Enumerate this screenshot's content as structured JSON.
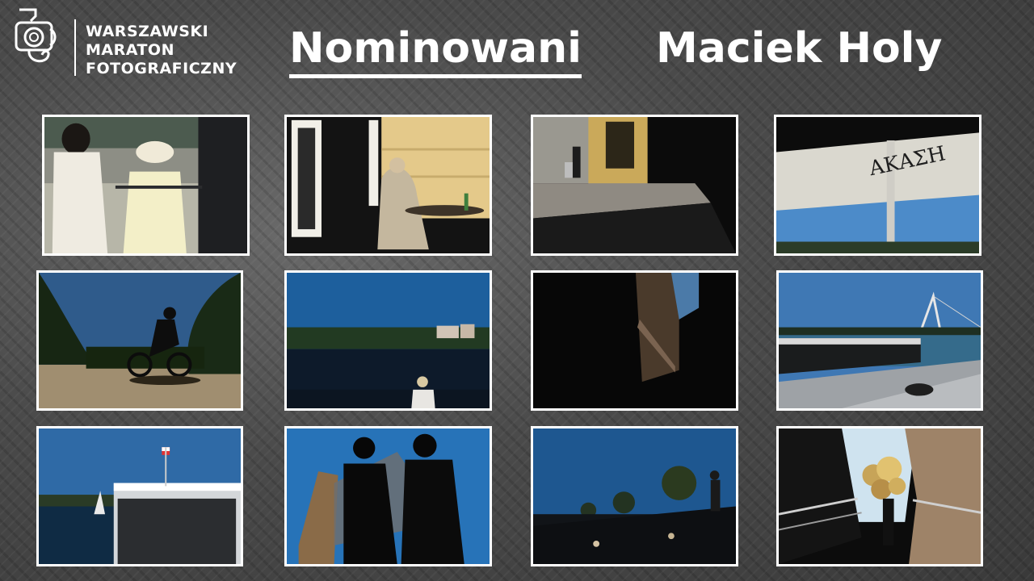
{
  "brand": {
    "logo_icon": "camera-heart-icon",
    "line1": "WARSZAWSKI",
    "line2": "MARATON",
    "line3": "FOTOGRAFICZNY"
  },
  "header": {
    "section_title": "Nominowani",
    "author_name": "Maciek Holy"
  },
  "gallery": {
    "photos": [
      {
        "id": "street-women-watching-parade"
      },
      {
        "id": "man-sitting-at-cafe-table"
      },
      {
        "id": "courtyard-shadow-person-with-cart"
      },
      {
        "id": "umbrella-from-below-sky"
      },
      {
        "id": "cyclist-silhouette-park"
      },
      {
        "id": "river-bank-woman-railing"
      },
      {
        "id": "dark-building-corner-sky"
      },
      {
        "id": "riverside-boat-bridge"
      },
      {
        "id": "moored-boat-with-flag"
      },
      {
        "id": "children-silhouettes-sky"
      },
      {
        "id": "crowd-on-riverside-steps"
      },
      {
        "id": "stairway-golden-balloons"
      }
    ]
  }
}
